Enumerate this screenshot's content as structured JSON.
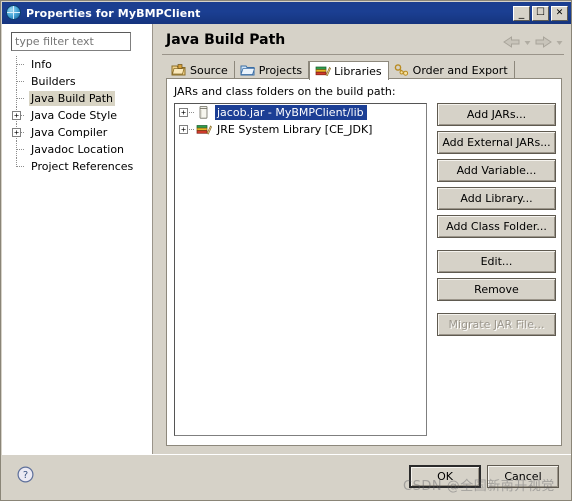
{
  "window": {
    "title": "Properties for MyBMPClient",
    "icon": "properties-globe-icon",
    "minimize_label": "_",
    "maximize_label": "☐",
    "close_label": "✕"
  },
  "sidebar": {
    "filter": {
      "value": "",
      "placeholder": "type filter text"
    },
    "items": [
      {
        "label": "Info",
        "expandable": false,
        "selected": false
      },
      {
        "label": "Builders",
        "expandable": false,
        "selected": false
      },
      {
        "label": "Java Build Path",
        "expandable": false,
        "selected": true
      },
      {
        "label": "Java Code Style",
        "expandable": true,
        "selected": false
      },
      {
        "label": "Java Compiler",
        "expandable": true,
        "selected": false
      },
      {
        "label": "Javadoc Location",
        "expandable": false,
        "selected": false
      },
      {
        "label": "Project References",
        "expandable": false,
        "selected": false
      }
    ],
    "expander_glyph": "+"
  },
  "page": {
    "title": "Java Build Path",
    "nav": {
      "back": "back-arrow",
      "back_menu": "back-dropdown",
      "forward": "forward-arrow",
      "forward_menu": "forward-dropdown"
    }
  },
  "tabs": [
    {
      "label": "Source",
      "icon": "source-folder-icon",
      "active": false
    },
    {
      "label": "Projects",
      "icon": "projects-folder-icon",
      "active": false
    },
    {
      "label": "Libraries",
      "icon": "libraries-books-icon",
      "active": true
    },
    {
      "label": "Order and Export",
      "icon": "order-export-key-icon",
      "active": false
    }
  ],
  "libraries": {
    "list_label": "JARs and class folders on the build path:",
    "entries": [
      {
        "label": "jacob.jar - MyBMPClient/lib",
        "icon": "jar-icon",
        "selected": true,
        "expandable": true
      },
      {
        "label": "JRE System Library [CE_JDK]",
        "icon": "library-books-icon",
        "selected": false,
        "expandable": true
      }
    ],
    "expander_glyph": "+",
    "buttons": [
      {
        "label": "Add JARs...",
        "enabled": true,
        "gap": false
      },
      {
        "label": "Add External JARs...",
        "enabled": true,
        "gap": false
      },
      {
        "label": "Add Variable...",
        "enabled": true,
        "gap": false
      },
      {
        "label": "Add Library...",
        "enabled": true,
        "gap": false
      },
      {
        "label": "Add Class Folder...",
        "enabled": true,
        "gap": false
      },
      {
        "label": "Edit...",
        "enabled": true,
        "gap": true
      },
      {
        "label": "Remove",
        "enabled": true,
        "gap": false
      },
      {
        "label": "Migrate JAR File...",
        "enabled": false,
        "gap": true
      }
    ]
  },
  "footer": {
    "help_icon": "help-question-icon",
    "ok_label": "OK",
    "cancel_label": "Cancel"
  },
  "watermark": {
    "text": "CSDN @全国新南开视觉"
  },
  "colors": {
    "titlebar": "#1b3f92",
    "selection": "#1c3f95",
    "tree_selection": "#d8d4c4",
    "dialog_face": "#d6d2c8"
  }
}
